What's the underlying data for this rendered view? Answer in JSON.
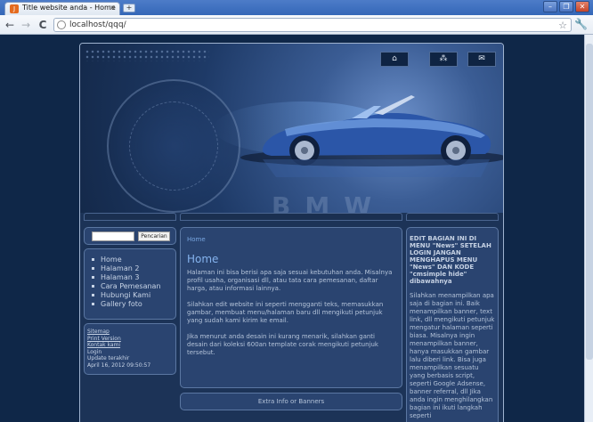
{
  "browser": {
    "tab_title": "Title website anda - Home",
    "url": "localhost/qqq/",
    "tab_close": "×",
    "new_tab": "+",
    "favicon": "J",
    "back": "←",
    "forward": "→",
    "reload": "C",
    "star": "☆",
    "wrench": "🔧",
    "minimize": "–",
    "restore": "❐",
    "close": "✕"
  },
  "header": {
    "icons": [
      "home-icon",
      "sitemap-icon",
      "mail-icon"
    ],
    "icon_glyphs": [
      "⌂",
      "⁂",
      "✉"
    ],
    "brand_text": "BMW"
  },
  "search": {
    "button_label": "Pencarian",
    "value": ""
  },
  "menu": {
    "items": [
      "Home",
      "Halaman 2",
      "Halaman 3",
      "Cara Pemesanan",
      "Hubungi Kami",
      "Gallery foto"
    ]
  },
  "footer_links": {
    "sitemap": "Sitemap",
    "print": "Print Version",
    "contact": "Kontak kami",
    "login": "Login",
    "updated_label": "Update terakhir",
    "updated_date": "April 16, 2012 09:50:57"
  },
  "main": {
    "breadcrumb": "Home",
    "title": "Home",
    "paragraphs": [
      "Halaman ini bisa berisi apa saja sesuai kebutuhan anda. Misalnya profil usaha, organisasi dll, atau tata cara pemesanan, daftar harga, atau informasi lainnya.",
      "Silahkan edit website ini seperti mengganti teks, memasukkan gambar, membuat menu/halaman baru dll mengikuti petunjuk yang sudah kami kirim ke email.",
      "Jika menurut anda desain ini kurang menarik, silahkan ganti desain dari koleksi 600an template corak mengikuti petunjuk tersebut."
    ]
  },
  "banner": {
    "text": "Extra Info or Banners"
  },
  "right_panel": {
    "heading": "EDIT BAGIAN INI DI MENU \"News\" SETELAH LOGIN JANGAN MENGHAPUS MENU \"News\" DAN KODE \"cmsimple hide\" dibawahnya",
    "body": "Silahkan menampilkan apa saja di bagian ini. Baik menampilkan banner, text link, dll mengikuti petunjuk mengatur halaman seperti biasa. Misalnya ingin menampilkan banner, hanya masukkan gambar lalu diberi link. Bisa juga menampilkan sesuatu yang berbasis script, seperti Google Adsense, banner referral, dll Jika anda ingin menghilangkan bagian ini ikuti langkah seperti"
  }
}
